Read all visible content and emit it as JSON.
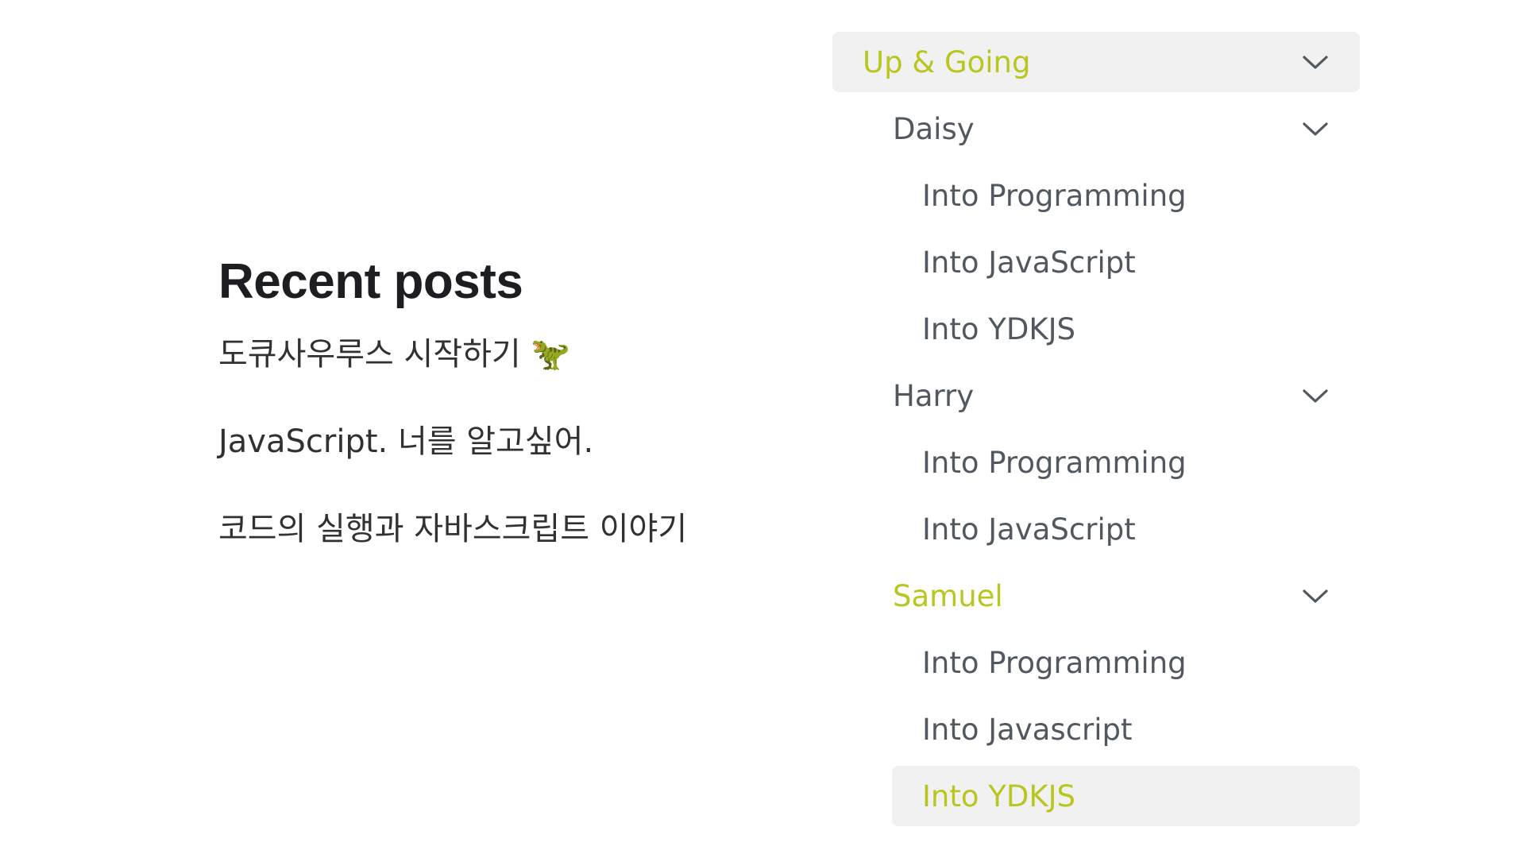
{
  "recent_posts": {
    "title": "Recent posts",
    "items": [
      "도큐사우루스 시작하기 🦖",
      "JavaScript. 너를 알고싶어.",
      "코드의 실행과 자바스크립트 이야기"
    ]
  },
  "sidebar": {
    "category": {
      "label": "Up & Going",
      "expanded": true,
      "active": true
    },
    "groups": [
      {
        "label": "Daisy",
        "expanded": true,
        "active": false,
        "items": [
          "Into Programming",
          "Into JavaScript",
          "Into YDKJS"
        ]
      },
      {
        "label": "Harry",
        "expanded": true,
        "active": false,
        "items": [
          "Into Programming",
          "Into JavaScript"
        ]
      },
      {
        "label": "Samuel",
        "expanded": true,
        "active": true,
        "items": [
          "Into Programming",
          "Into Javascript",
          "Into YDKJS"
        ],
        "active_item": "Into YDKJS"
      }
    ]
  },
  "colors": {
    "accent": "#b9c61f",
    "text": "#525860",
    "heading": "#1c1e21",
    "active_background": "#f1f1f1"
  },
  "icons": {
    "caret": "chevron-down-icon"
  }
}
